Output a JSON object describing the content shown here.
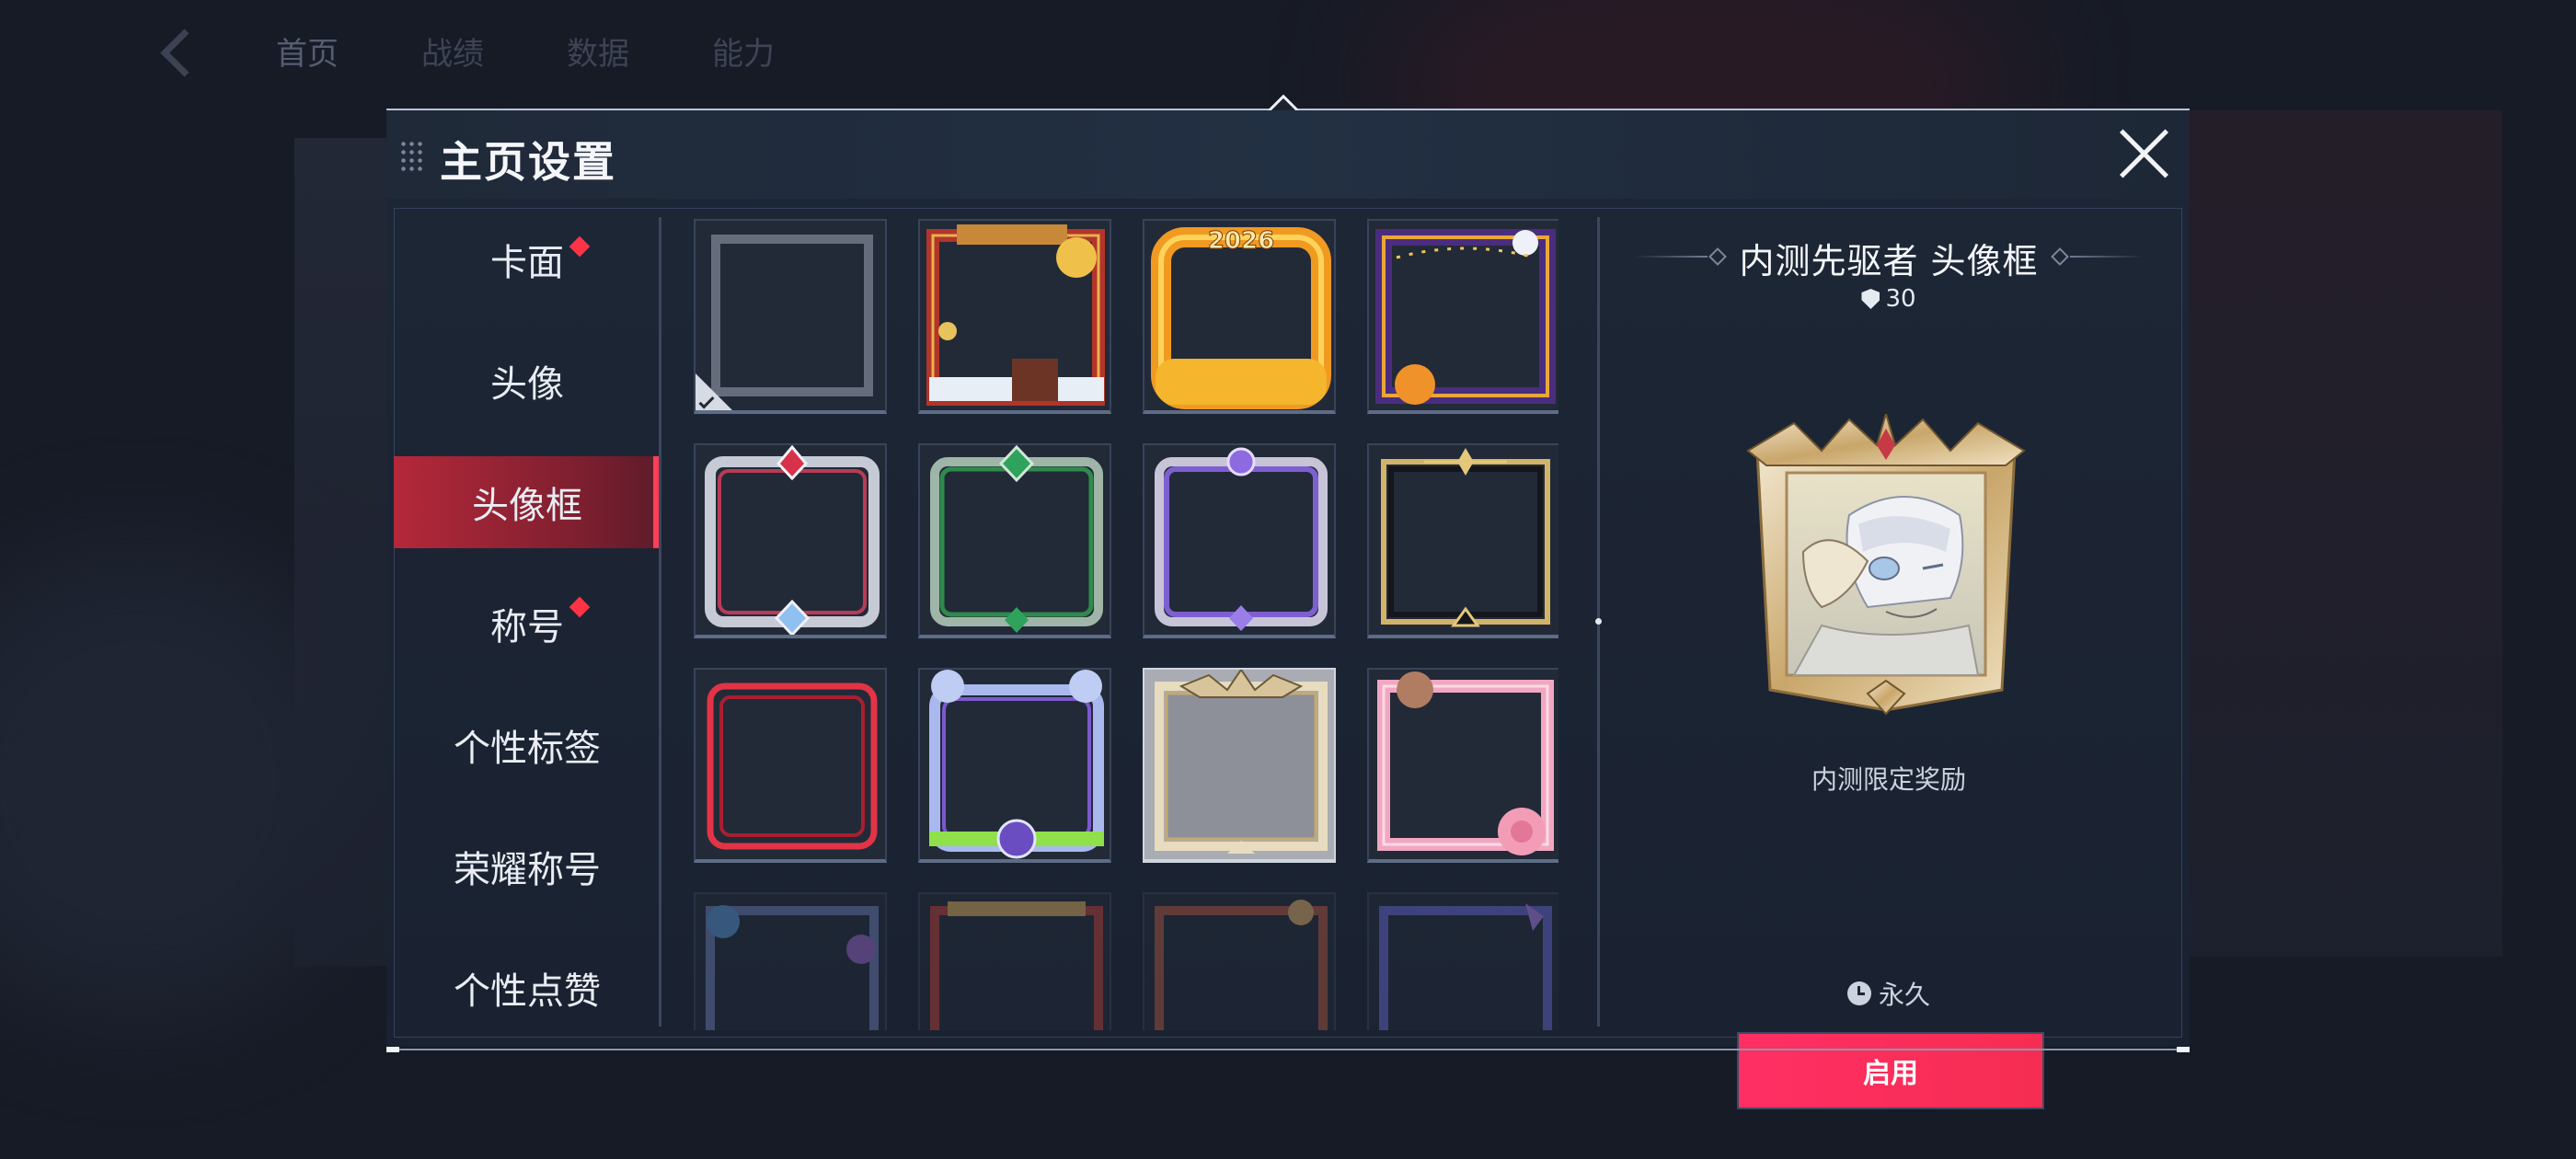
{
  "background": {
    "nav_tabs": [
      "首页",
      "战绩",
      "数据",
      "能力"
    ]
  },
  "dialog": {
    "title": "主页设置",
    "close_icon": "close-x-icon"
  },
  "tabs": [
    {
      "label": "卡面",
      "badge": true,
      "active": false
    },
    {
      "label": "头像",
      "badge": false,
      "active": false
    },
    {
      "label": "头像框",
      "badge": false,
      "active": true
    },
    {
      "label": "称号",
      "badge": true,
      "active": false
    },
    {
      "label": "个性标签",
      "badge": false,
      "active": false
    },
    {
      "label": "荣耀称号",
      "badge": false,
      "active": false
    },
    {
      "label": "个性点赞",
      "badge": false,
      "active": false
    }
  ],
  "frames": [
    {
      "name": "default-frame",
      "selected": true
    },
    {
      "name": "spring-festival-frame"
    },
    {
      "name": "2026-fire-frame",
      "text": "2026"
    },
    {
      "name": "halloween-frame"
    },
    {
      "name": "silver-red-frame"
    },
    {
      "name": "green-emerald-frame"
    },
    {
      "name": "violet-crystal-frame"
    },
    {
      "name": "black-gold-frame"
    },
    {
      "name": "red-neon-frame"
    },
    {
      "name": "bear-ears-frame"
    },
    {
      "name": "pioneer-gold-frame",
      "highlighted": true
    },
    {
      "name": "pink-rose-frame"
    },
    {
      "name": "butterfly-frame"
    },
    {
      "name": "red-lantern-frame"
    },
    {
      "name": "copper-ornate-frame"
    },
    {
      "name": "blue-violet-frame"
    }
  ],
  "detail": {
    "title": "内测先驱者 头像框",
    "rarity_icon": "shield-icon",
    "rarity_value": "30",
    "source": "内测限定奖励",
    "duration_icon": "clock-icon",
    "duration": "永久",
    "apply_label": "启用"
  },
  "colors": {
    "accent_red": "#ff3346",
    "button_gradient_start": "#ff2f64",
    "button_gradient_end": "#f62d52",
    "panel_bg": "#1d2635"
  }
}
